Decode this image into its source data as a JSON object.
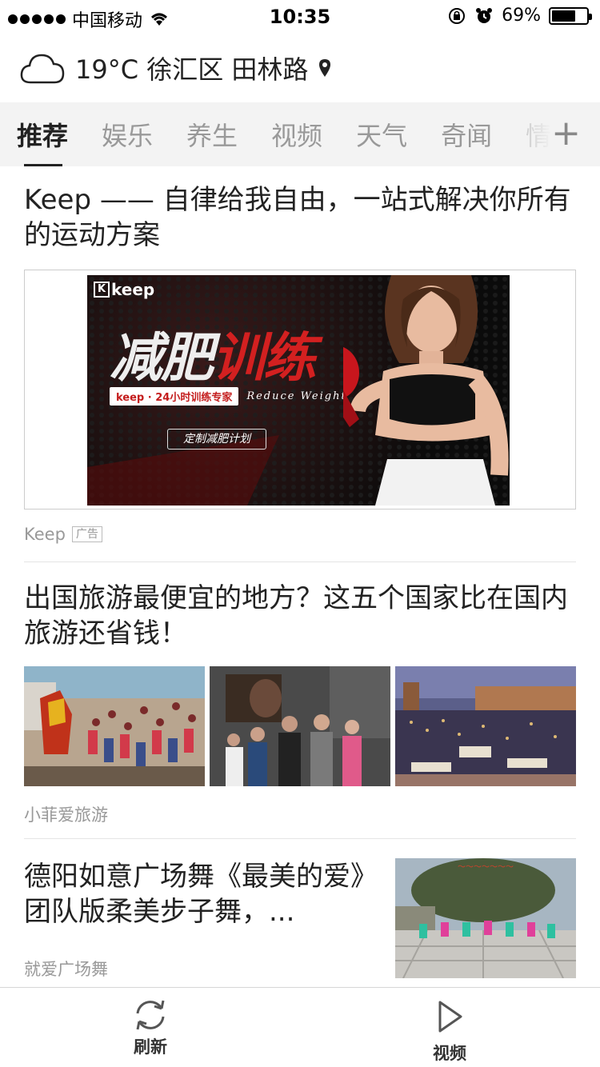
{
  "status_bar": {
    "carrier": "中国移动",
    "time": "10:35",
    "battery": "69%",
    "battery_level": 0.69
  },
  "weather": {
    "icon": "cloud-icon",
    "text": "19°C 徐汇区 田林路",
    "location_icon": "location-pin-icon"
  },
  "tabs": {
    "items": [
      {
        "label": "推荐",
        "active": true
      },
      {
        "label": "娱乐"
      },
      {
        "label": "养生"
      },
      {
        "label": "视频"
      },
      {
        "label": "天气"
      },
      {
        "label": "奇闻"
      },
      {
        "label": "情"
      }
    ],
    "more_icon": "plus-icon"
  },
  "articles": [
    {
      "title": "Keep —— 自律给我自由，一站式解决你所有的运动方案",
      "source": "Keep",
      "tag": "广告",
      "ad": {
        "logo": "keep",
        "logo_letter": "K",
        "headline_white": "减肥",
        "headline_red": "训练",
        "badge": "keep · 24小时训练专家",
        "subtitle_en": "Reduce Weight",
        "cta": "定制减肥计划"
      }
    },
    {
      "title": "出国旅游最便宜的地方？这五个国家比在国内旅游还省钱！",
      "source": "小菲爱旅游"
    },
    {
      "title": "德阳如意广场舞《最美的爱》团队版柔美步子舞，...",
      "source": "就爱广场舞"
    }
  ],
  "bottom_bar": {
    "refresh_label": "刷新",
    "video_label": "视频"
  }
}
